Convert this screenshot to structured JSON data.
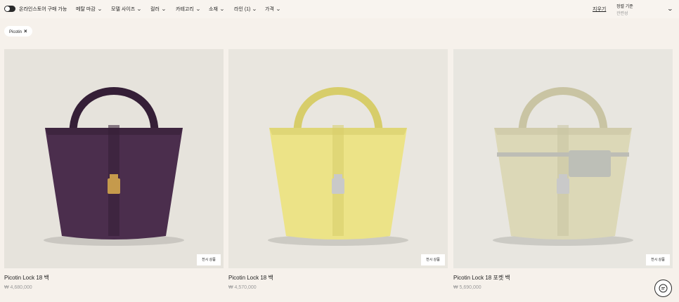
{
  "filters": {
    "online_toggle_label": "온라인스토어 구매 가능",
    "items": [
      {
        "label": "메탈 마감"
      },
      {
        "label": "모델 사이즈"
      },
      {
        "label": "컬러"
      },
      {
        "label": "카테고리"
      },
      {
        "label": "소재"
      },
      {
        "label": "라인 (1)"
      },
      {
        "label": "가격"
      }
    ],
    "clear_label": "지우기",
    "sort_label": "정렬 기준",
    "sort_value": "관련성"
  },
  "active_chip": {
    "label": "Picotin",
    "remove_icon": "close-icon"
  },
  "products": [
    {
      "name": "Picotin Lock 18 백",
      "price": "₩ 4,680,000",
      "display_label": "전시 상품",
      "bag_color": "#4b2e4d",
      "bag_color_dark": "#351f37",
      "lock_color": "#c59a4c",
      "bg": "#e6e3dc"
    },
    {
      "name": "Picotin Lock 18 백",
      "price": "₩ 4,570,000",
      "display_label": "전시 상품",
      "bag_color": "#ece387",
      "bag_color_dark": "#d7cd6a",
      "lock_color": "#c9c9c9",
      "bg": "#e9e6df"
    },
    {
      "name": "Picotin Lock 18 포켓 백",
      "price": "₩ 5,690,000",
      "display_label": "전시 상품",
      "bag_color": "#dcd8b7",
      "bag_color_dark": "#c9c4a3",
      "lock_color": "#c9c9c9",
      "bg": "#e8e6e0"
    }
  ],
  "chat": {
    "icon": "chat-icon"
  }
}
